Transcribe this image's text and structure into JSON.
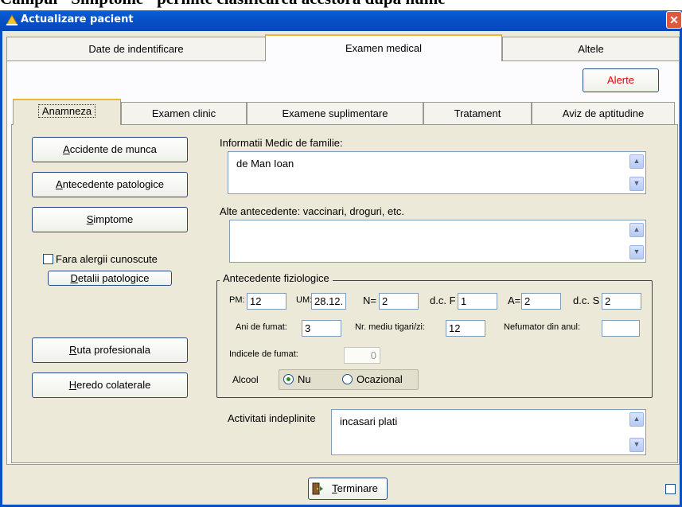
{
  "headline": "Campul \"Simptome\" permite clasificarea acestora dupa nume",
  "window": {
    "title": "Actualizare pacient",
    "close": "✕"
  },
  "top_tabs": [
    "Date de indentificare",
    "Examen medical",
    "Altele"
  ],
  "alert_button": "Alerte",
  "sub_tabs": [
    "Anamneza",
    "Examen clinic",
    "Examene suplimentare",
    "Tratament",
    "Aviz de aptitudine"
  ],
  "left_buttons": {
    "accidente": {
      "pre": "",
      "u": "A",
      "post": "ccidente de munca"
    },
    "antecedente": {
      "pre": "",
      "u": "A",
      "post": "ntecedente patologice"
    },
    "simptome": {
      "pre": "",
      "u": "S",
      "post": "imptome"
    },
    "detalii": {
      "pre": "",
      "u": "D",
      "post": "etalii patologice"
    },
    "ruta": {
      "pre": "",
      "u": "R",
      "post": "uta profesionala"
    },
    "heredo": {
      "pre": "",
      "u": "H",
      "post": "eredo colaterale"
    }
  },
  "allergies_checkbox": "Fara alergii cunoscute",
  "family_doctor": {
    "label": "Informatii Medic de familie:",
    "value": "de Man Ioan"
  },
  "other_history": {
    "label": "Alte antecedente: vaccinari, droguri, etc.",
    "value": ""
  },
  "physio": {
    "title": "Antecedente fiziologice",
    "pm_label": "PM:",
    "pm": "12",
    "um_label": "UM:",
    "um": "28.12.",
    "n_label": "N=",
    "n": "2",
    "dcf_label": "d.c. F",
    "dcf": "1",
    "a_label": "A=",
    "a": "2",
    "dcs_label": "d.c. S",
    "dcs": "2",
    "ani_label": "Ani de fumat:",
    "ani": "3",
    "nr_label": "Nr. mediu tigari/zi:",
    "nr": "12",
    "nefum_label": "Nefumator din anul:",
    "nefum": "",
    "indice_label": "Indicele de fumat:",
    "indice": "0",
    "alcool_label": "Alcool",
    "alcool_nu": "Nu",
    "alcool_ocaz": "Ocazional"
  },
  "activities": {
    "label": "Activitati indeplinite",
    "value": "incasari plati"
  },
  "finish_button": {
    "pre": "",
    "u": "T",
    "post": "erminare"
  },
  "colors": {
    "title_bar": "#0652c8",
    "tab_highlight": "#f3b43a",
    "alert_text": "#ee0000",
    "dialog_bg": "#ece9d8"
  }
}
